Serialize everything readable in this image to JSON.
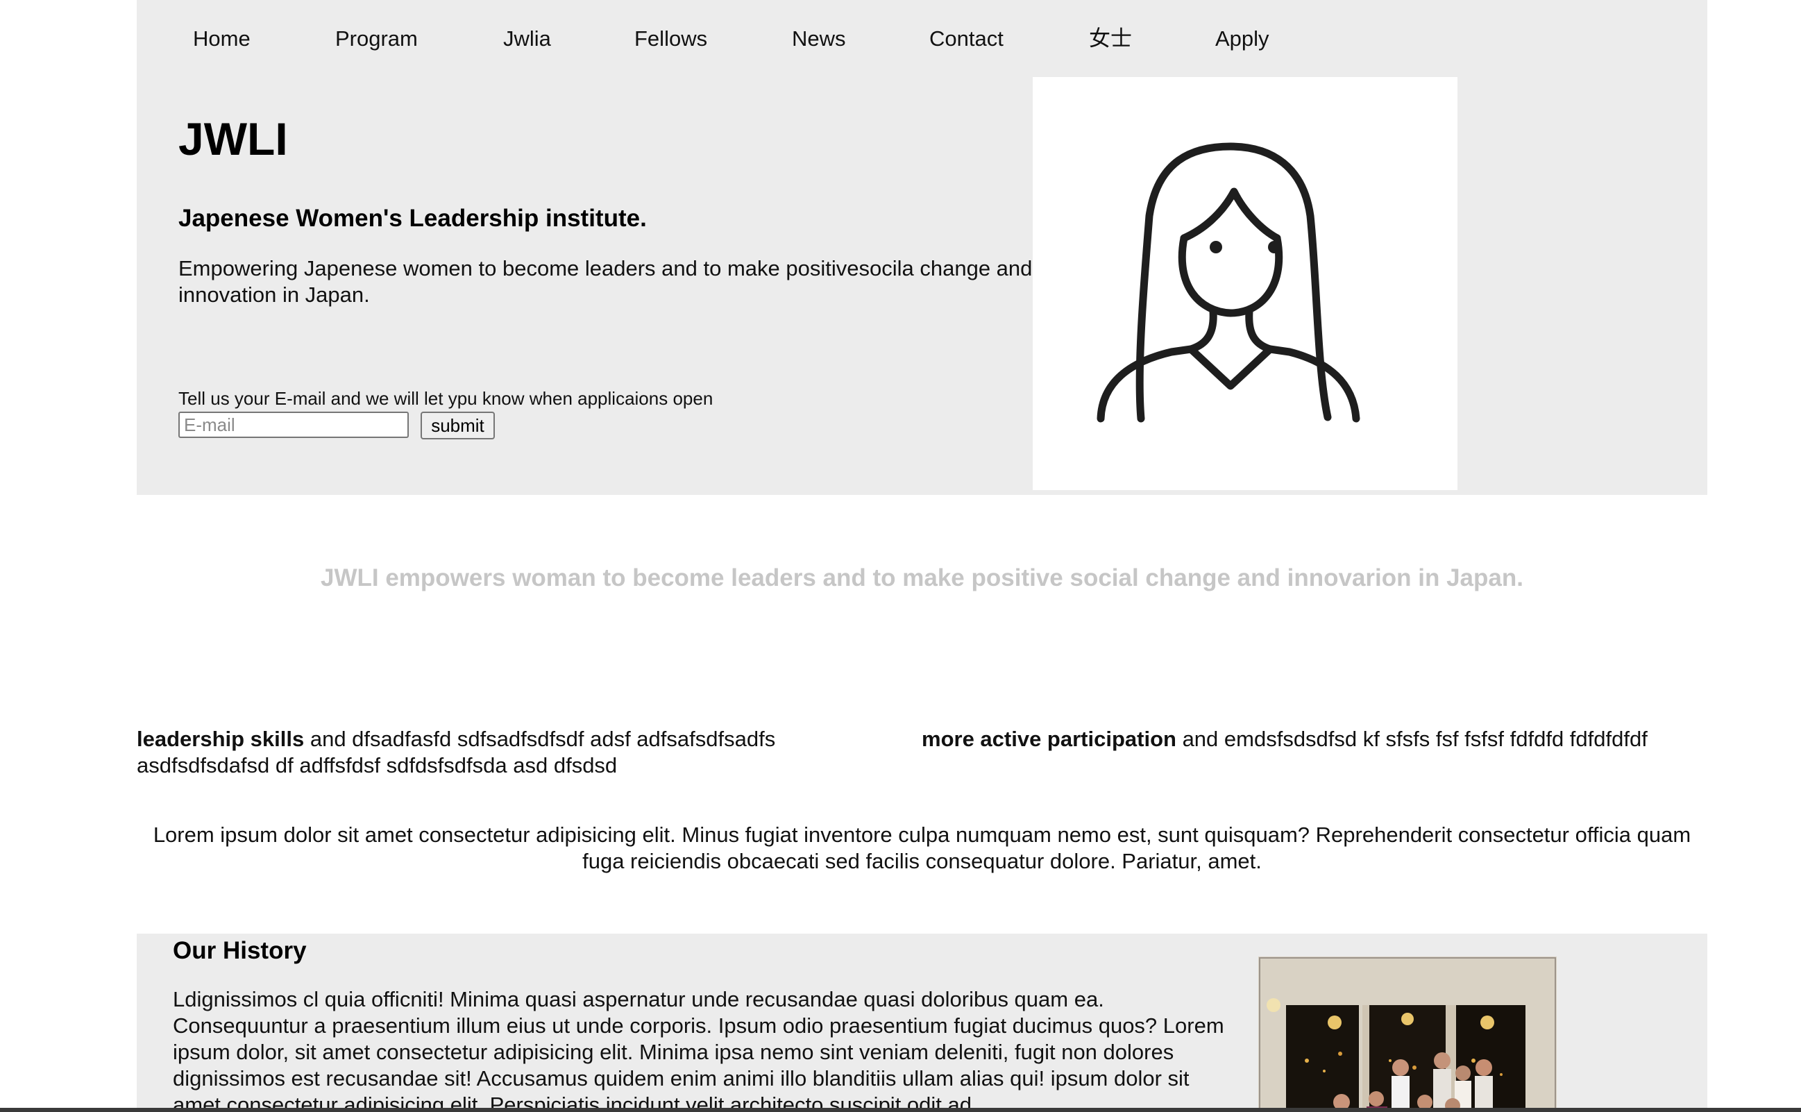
{
  "nav": {
    "items": [
      {
        "label": "Home"
      },
      {
        "label": "Program"
      },
      {
        "label": "Jwlia"
      },
      {
        "label": "Fellows"
      },
      {
        "label": "News"
      },
      {
        "label": "Contact"
      },
      {
        "label": "女士"
      },
      {
        "label": "Apply"
      }
    ]
  },
  "hero": {
    "title": "JWLI",
    "subtitle": "Japenese Women's Leadership institute.",
    "description": "Empowering Japenese women to become leaders and to make positivesocila change and innovation in Japan.",
    "signup_text": "Tell us your E-mail and we will let ypu know when applicaions open",
    "email_placeholder": "E-mail",
    "email_value": "",
    "submit_label": "submit",
    "avatar_icon": "woman-avatar-icon"
  },
  "tagline": "JWLI empowers woman to become leaders and to make positive social change and innovarion in Japan.",
  "features": [
    {
      "bold": "leadership skills",
      "text": " and dfsadfasfd sdfsadfsdfsdf adsf adfsafsdfsadfs asdfsdfsdafsd df adffsfdsf sdfdsfsdfsda asd dfsdsd"
    },
    {
      "bold": "more active participation",
      "text": " and emdsfsdsdfsd kf sfsfs fsf fsfsf fdfdfd fdfdfdfdf"
    }
  ],
  "lorem": "Lorem ipsum dolor sit amet consectetur adipisicing elit. Minus fugiat inventore culpa numquam nemo est, sunt quisquam? Reprehenderit consectetur officia quam fuga reiciendis obcaecati sed facilis consequatur dolore. Pariatur, amet.",
  "history": {
    "title": "Our History",
    "text": "Ldignissimos cl quia officniti! Minima quasi aspernatur unde recusandae quasi doloribus quam ea. Consequuntur a praesentium illum eius ut unde corporis. Ipsum odio praesentium fugiat ducimus quos? Lorem ipsum dolor, sit amet consectetur adipisicing elit. Minima ipsa nemo sint veniam deleniti, fugit non dolores dignissimos est recusandae sit! Accusamus quidem enim animi illo blanditiis ullam alias qui! ipsum dolor sit amet consectetur adipisicing elit. Perspiciatis incidunt velit architecto suscipit odit ad",
    "photo": "group-photo"
  },
  "colors": {
    "section_bg": "#ececec",
    "tagline": "#c6c6c6",
    "text": "#111111"
  }
}
